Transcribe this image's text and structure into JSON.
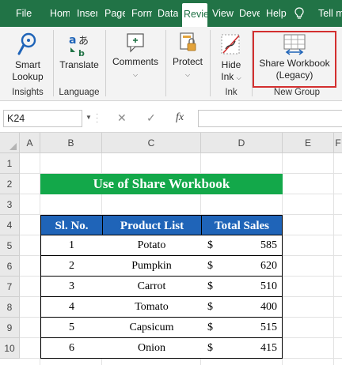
{
  "tabs": [
    {
      "label": "File"
    },
    {
      "label": "Home"
    },
    {
      "label": "Insert"
    },
    {
      "label": "Page Layout"
    },
    {
      "label": "Formulas"
    },
    {
      "label": "Data"
    },
    {
      "label": "Review"
    },
    {
      "label": "View"
    },
    {
      "label": "Developer"
    },
    {
      "label": "Help"
    }
  ],
  "tell_me": "Tell me",
  "ribbon": {
    "smart_lookup": "Smart Lookup",
    "smart_lookup_l1": "Smart",
    "smart_lookup_l2": "Lookup",
    "translate": "Translate",
    "comments": "Comments",
    "protect": "Protect",
    "hide_ink_l1": "Hide",
    "hide_ink_l2": "Ink",
    "share_l1": "Share Workbook",
    "share_l2": "(Legacy)",
    "groups": {
      "insights": "Insights",
      "language": "Language",
      "ink": "Ink",
      "new_group": "New Group"
    }
  },
  "formula_bar": {
    "name_box": "K24",
    "cancel": "✕",
    "enter": "✓",
    "fx": "fx",
    "value": ""
  },
  "columns": [
    "A",
    "B",
    "C",
    "D",
    "E",
    "F"
  ],
  "rows": [
    "1",
    "2",
    "3",
    "4",
    "5",
    "6",
    "7",
    "8",
    "9",
    "10"
  ],
  "sheet_title": "Use of Share Workbook",
  "table": {
    "headers": [
      "Sl. No.",
      "Product List",
      "Total Sales"
    ],
    "currency": "$",
    "rows": [
      {
        "sl": "1",
        "product": "Potato",
        "sales": "585"
      },
      {
        "sl": "2",
        "product": "Pumpkin",
        "sales": "620"
      },
      {
        "sl": "3",
        "product": "Carrot",
        "sales": "510"
      },
      {
        "sl": "4",
        "product": "Tomato",
        "sales": "400"
      },
      {
        "sl": "5",
        "product": "Capsicum",
        "sales": "515"
      },
      {
        "sl": "6",
        "product": "Onion",
        "sales": "415"
      }
    ]
  },
  "colors": {
    "ribbon_tab_bar": "#217346",
    "title_fill": "#13a84a",
    "header_fill": "#1f64b8",
    "highlight_box": "#d32f2f"
  }
}
